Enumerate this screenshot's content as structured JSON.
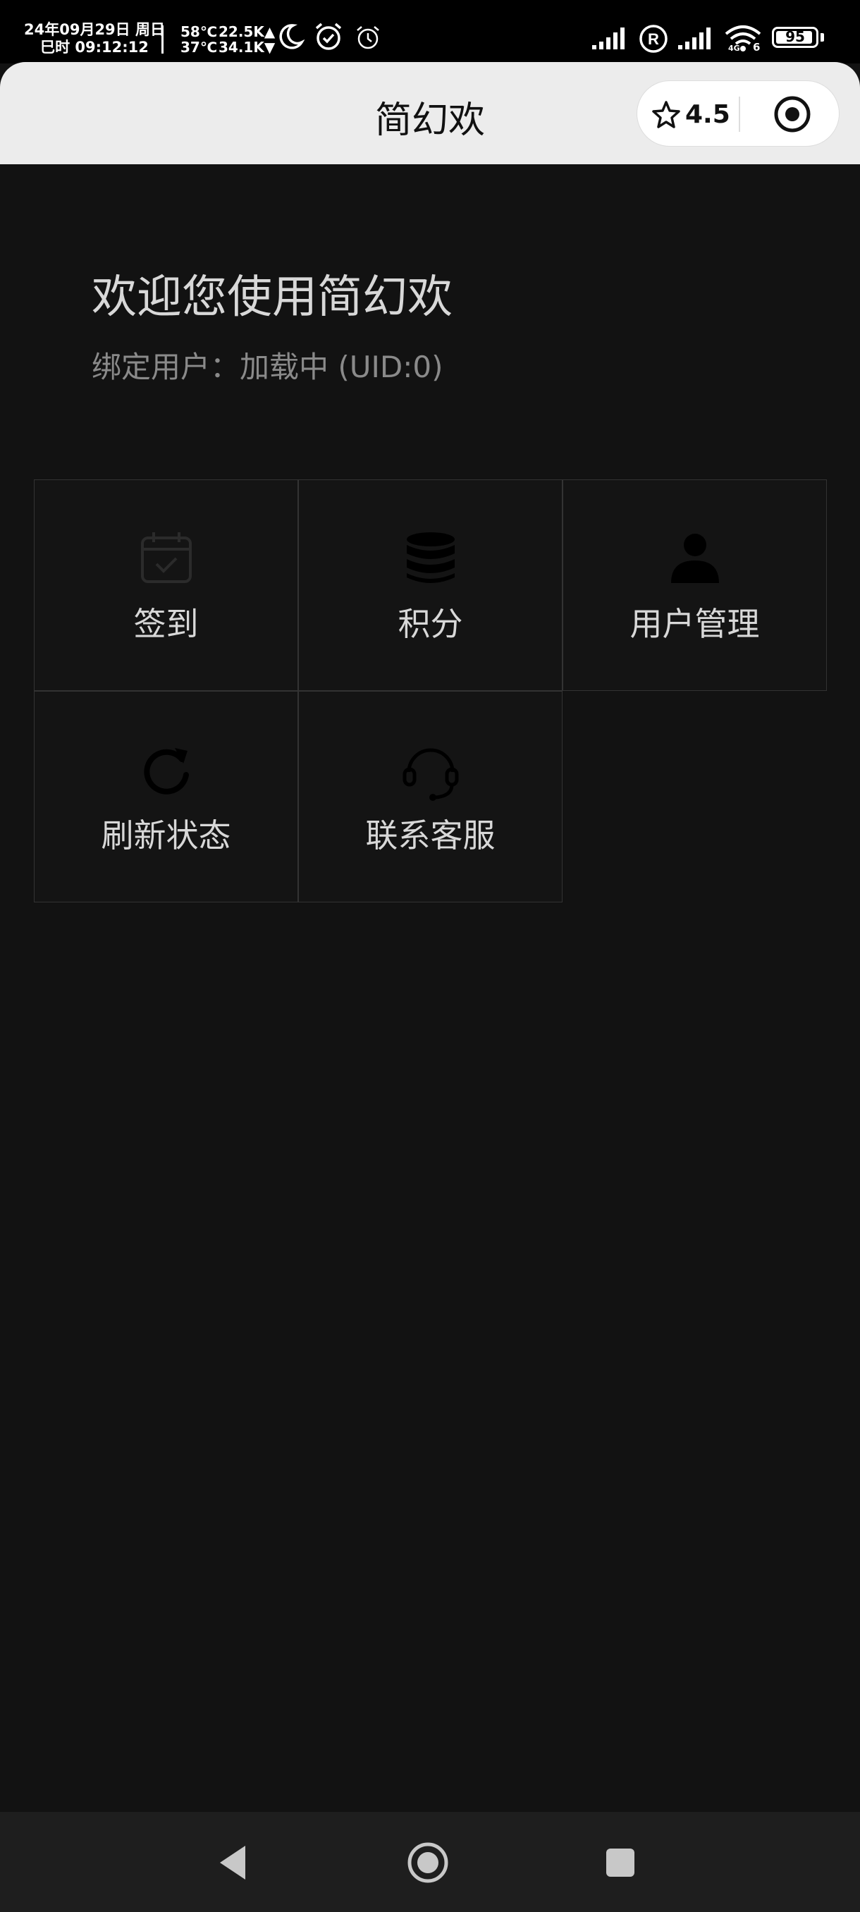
{
  "status_bar": {
    "date_line": "24年09月29日 周日",
    "time_line": "巳时 09:12:12",
    "temp_high": "58℃",
    "temp_low": "37℃",
    "upload_speed": "22.5K▲",
    "download_speed": "34.1K▼",
    "network_type": "4G",
    "wifi_badge": "6",
    "battery": "95",
    "icons": [
      "moon-icon",
      "alarm-check-icon",
      "alarm-icon",
      "signal-icon",
      "registered-icon",
      "wifi-icon",
      "battery-icon"
    ]
  },
  "header": {
    "title": "简幻欢",
    "rating": "4.5",
    "icons": [
      "star-icon",
      "target-icon"
    ]
  },
  "welcome": {
    "title": "欢迎您使用简幻欢",
    "subtitle": "绑定用户：加载中 (UID:0)"
  },
  "grid": {
    "items": [
      {
        "label": "签到",
        "icon": "calendar-check-icon"
      },
      {
        "label": "积分",
        "icon": "coins-stack-icon"
      },
      {
        "label": "用户管理",
        "icon": "user-icon"
      },
      {
        "label": "刷新状态",
        "icon": "refresh-icon"
      },
      {
        "label": "联系客服",
        "icon": "headset-icon"
      }
    ]
  },
  "nav_bar": {
    "icons": [
      "back-icon",
      "home-icon",
      "recents-icon"
    ]
  },
  "colors": {
    "background": "#121212",
    "header_bg": "#ececec",
    "text_primary": "#d8d8d8",
    "text_secondary": "#8a8a8a"
  }
}
